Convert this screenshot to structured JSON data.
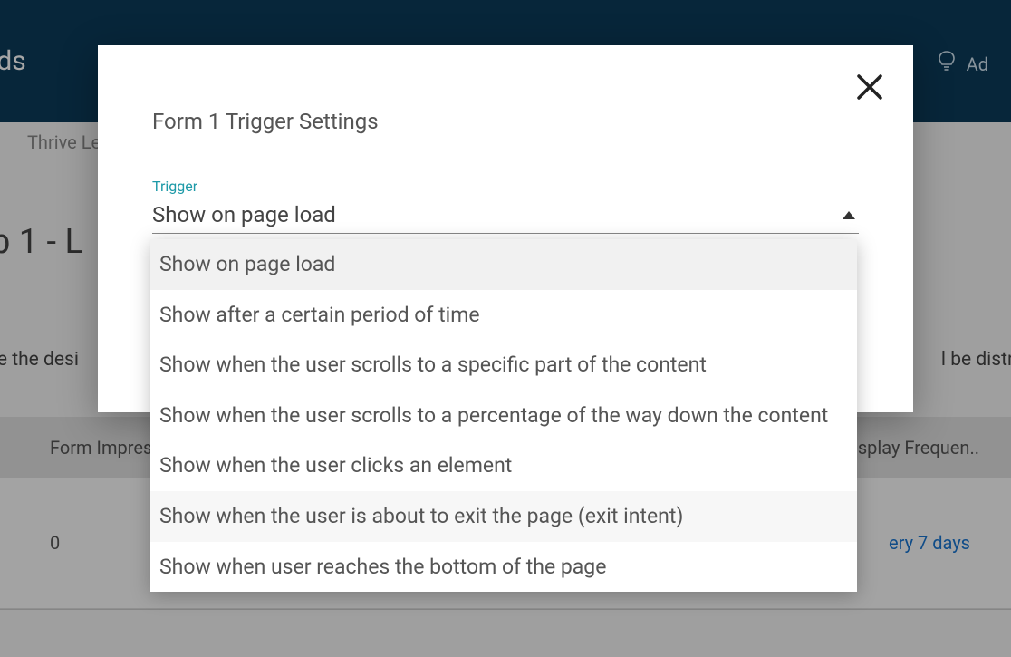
{
  "header": {
    "title": "ads",
    "right_label": "Ad"
  },
  "breadcrumb": "Thrive Le",
  "page_title": "p 1 - L",
  "description_left": "te the desi",
  "description_right": "l be distrib",
  "table": {
    "col_impressions": "Form Impres",
    "col_frequency": "splay Frequen..",
    "row_impressions": "0",
    "row_frequency": "ery 7 days"
  },
  "modal": {
    "title": "Form 1 Trigger Settings",
    "trigger_label": "Trigger",
    "selected": "Show on page load"
  },
  "dropdown": {
    "items": [
      "Show on page load",
      "Show after a certain period of time",
      "Show when the user scrolls to a specific part of the content",
      "Show when the user scrolls to a percentage of the way down the content",
      "Show when the user clicks an element",
      "Show when the user is about to exit the page (exit intent)",
      "Show when user reaches the bottom of the page"
    ]
  }
}
